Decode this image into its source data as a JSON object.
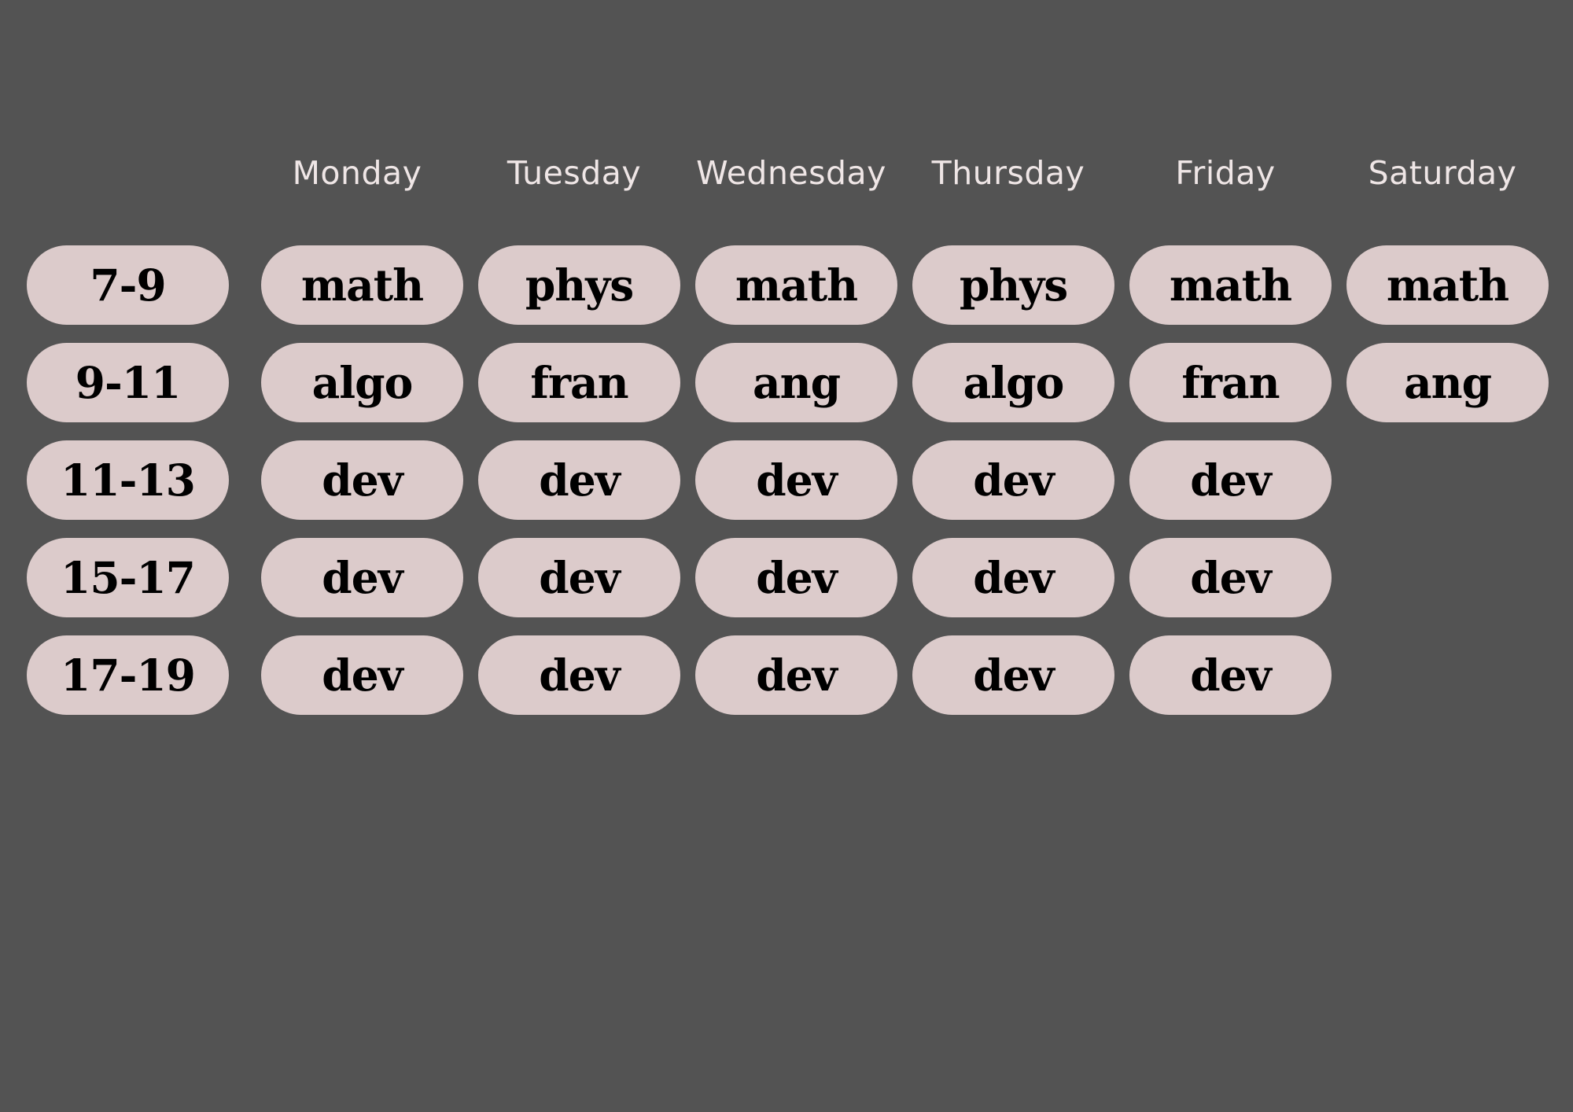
{
  "colors": {
    "background": "#535353",
    "pill": "#dccbcb",
    "header_text": "#efe6e6",
    "pill_text": "#000000"
  },
  "days": [
    "Monday",
    "Tuesday",
    "Wednesday",
    "Thursday",
    "Friday",
    "Saturday"
  ],
  "slots": [
    {
      "time": "7-9",
      "classes": [
        "math",
        "phys",
        "math",
        "phys",
        "math",
        "math"
      ]
    },
    {
      "time": "9-11",
      "classes": [
        "algo",
        "fran",
        "ang",
        "algo",
        "fran",
        "ang"
      ]
    },
    {
      "time": "11-13",
      "classes": [
        "dev",
        "dev",
        "dev",
        "dev",
        "dev"
      ]
    },
    {
      "time": "15-17",
      "classes": [
        "dev",
        "dev",
        "dev",
        "dev",
        "dev"
      ]
    },
    {
      "time": "17-19",
      "classes": [
        "dev",
        "dev",
        "dev",
        "dev",
        "dev"
      ]
    }
  ]
}
